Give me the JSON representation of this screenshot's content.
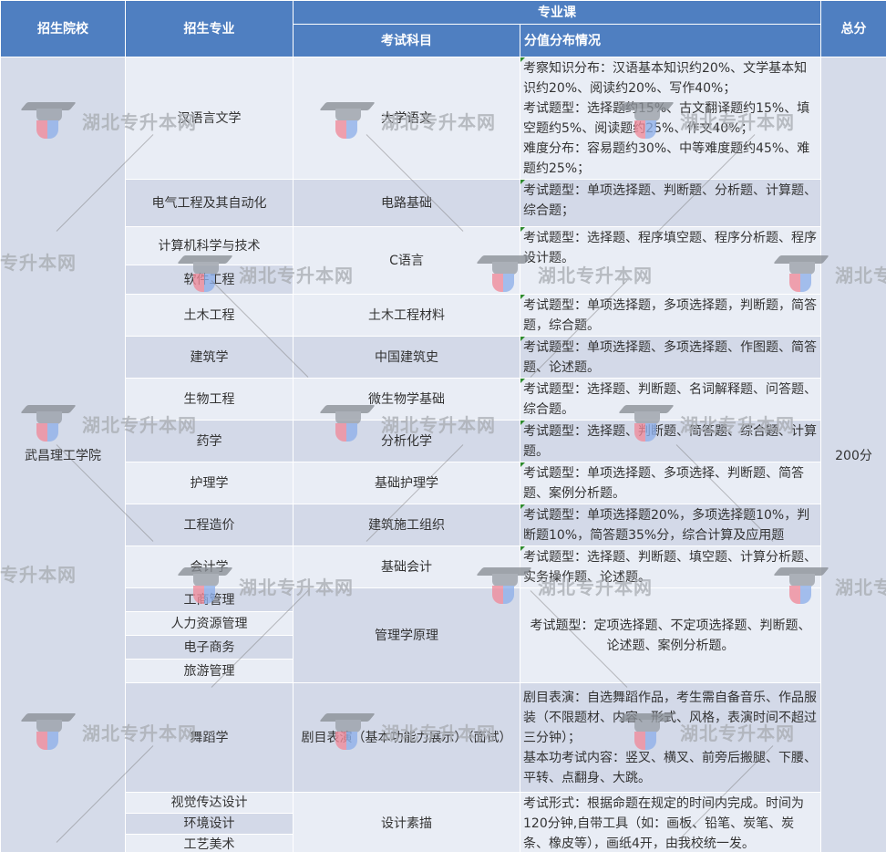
{
  "header": {
    "school": "招生院校",
    "major": "招生专业",
    "group": "专业课",
    "subject": "考试科目",
    "distribution": "分值分布情况",
    "total": "总分"
  },
  "school_name": "武昌理工学院",
  "total_score": "200分",
  "rows": {
    "hanyu": {
      "major": "汉语言文学",
      "subject": "大学语文",
      "desc": "考察知识分布：汉语基本知识约20%、文学基本知识约20%、阅读约20%、写作40%；\n考试题型：选择题约15%、古文翻译题约15%、填空题约5%、阅读题约25%、作文40%；\n难度分布：容易题约30%、中等难度题约45%、难题约25%；"
    },
    "dianqi": {
      "major": "电气工程及其自动化",
      "subject": "电路基础",
      "desc": "考试题型：单项选择题、判断题、分析题、计算题、综合题；"
    },
    "jisuanji": {
      "major": "计算机科学与技术",
      "major2": "软件工程",
      "subject": "C语言",
      "desc": "考试题型：选择题、程序填空题、程序分析题、程序设计题。"
    },
    "tumu": {
      "major": "土木工程",
      "subject": "土木工程材料",
      "desc": "考试题型：单项选择题，多项选择题，判断题，简答题，综合题。"
    },
    "jianzhu": {
      "major": "建筑学",
      "subject": "中国建筑史",
      "desc": "考试题型：单项选择题、多项选择题、作图题、简答题、论述题。"
    },
    "shengwu": {
      "major": "生物工程",
      "subject": "微生物学基础",
      "desc": "考试题型：选择题、判断题、名词解释题、问答题、综合题。"
    },
    "yaoxue": {
      "major": "药学",
      "subject": "分析化学",
      "desc": "考试题型：选择题、判断题、简答题、综合题、计算题。"
    },
    "huli": {
      "major": "护理学",
      "subject": "基础护理学",
      "desc": "考试题型：单项选择题、多项选择、判断题、简答题、案例分析题。"
    },
    "gongcheng": {
      "major": "工程造价",
      "subject": "建筑施工组织",
      "desc": "考试题型：单项选择题20%，多项选择题10%，判断题10%，简答题35%分，综合计算及应用题"
    },
    "kuaiji": {
      "major": "会计学",
      "subject": "基础会计",
      "desc": "考试题型：选择题、判断题、填空题、计算分析题、实务操作题、论述题。"
    },
    "guanli": {
      "majors": [
        "工商管理",
        "人力资源管理",
        "电子商务",
        "旅游管理"
      ],
      "subject": "管理学原理",
      "desc": "考试题型：定项选择题、不定项选择题、判断题、论述题、案例分析题。"
    },
    "wudao": {
      "major": "舞蹈学",
      "subject": "剧目表演（基本功能力展示）（面试）",
      "desc": "剧目表演：自选舞蹈作品，考生需自备音乐、作品服装（不限题材、内容、形式、风格，表演时间不超过三分钟）；\n基本功考试内容：竖叉、横叉、前旁后搬腿、下腰、平转、点翻身、大跳。"
    },
    "sheji": {
      "majors": [
        "视觉传达设计",
        "环境设计",
        "工艺美术"
      ],
      "subject": "设计素描",
      "desc": "考试形式：根据命题在规定的时间内完成。时间为120分钟,自带工具（如：画板、铅笔、炭笔、炭条、橡皮等），画纸4开，由我校统一发。"
    }
  },
  "watermark": {
    "text": "湖北专升本网",
    "text_partial_left": "专升本网",
    "text_partial_right": "湖北专",
    "icon": "graduation-cap-shield-icon",
    "color": "#a9adb3"
  },
  "colors": {
    "header_bg": "#4f7fc1",
    "row_light": "#e9edf5",
    "row_dark": "#d3d9e8",
    "corner_mark": "#2e8b2e"
  }
}
